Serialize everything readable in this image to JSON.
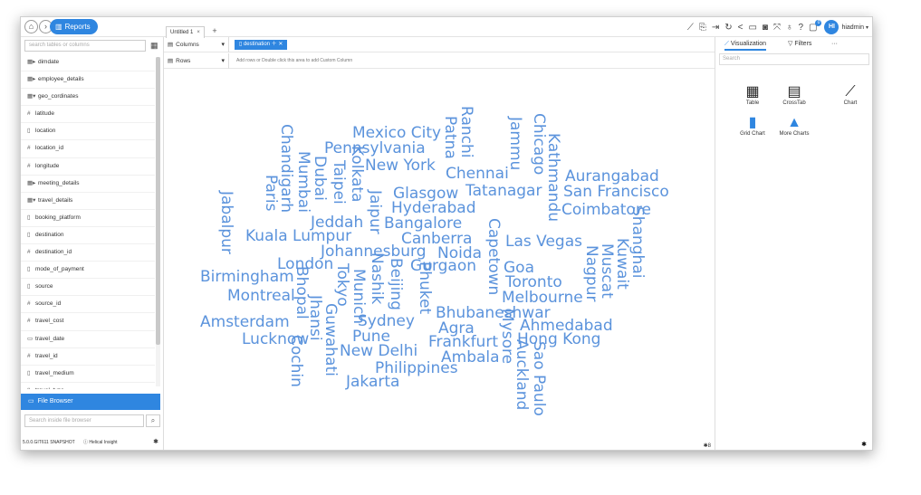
{
  "header": {
    "home_icon": "home-icon",
    "forward_icon": "chevron-right-icon",
    "reports_label": "Reports",
    "tab_label": "Untitled 1",
    "tab_close": "×",
    "tab_add": "+",
    "toolbar_icons": [
      "line-chart-icon",
      "export-icon",
      "exit-icon",
      "refresh-icon",
      "share-icon",
      "layout-icon",
      "camera-icon",
      "fullscreen-icon",
      "bulb-icon",
      "help-icon",
      "notification-icon"
    ],
    "notification_count": "0",
    "avatar_initials": "HI",
    "username": "hiadmin"
  },
  "left_panel": {
    "search_placeholder": "search tables or columns",
    "tree": [
      {
        "label": "dimdate",
        "icon": "table-expand-icon",
        "glyph": "▦▸"
      },
      {
        "label": "employee_details",
        "icon": "table-expand-icon",
        "glyph": "▦▸"
      },
      {
        "label": "geo_cordinates",
        "icon": "table-collapse-icon",
        "glyph": "▦▾"
      },
      {
        "label": "latitude",
        "icon": "numeric-icon",
        "glyph": "#"
      },
      {
        "label": "location",
        "icon": "text-icon",
        "glyph": "▯"
      },
      {
        "label": "location_id",
        "icon": "numeric-icon",
        "glyph": "#"
      },
      {
        "label": "longitude",
        "icon": "numeric-icon",
        "glyph": "#"
      },
      {
        "label": "meeting_details",
        "icon": "table-expand-icon",
        "glyph": "▦▸"
      },
      {
        "label": "travel_details",
        "icon": "table-collapse-icon",
        "glyph": "▦▾"
      },
      {
        "label": "booking_platform",
        "icon": "text-icon",
        "glyph": "▯"
      },
      {
        "label": "destination",
        "icon": "text-icon",
        "glyph": "▯"
      },
      {
        "label": "destination_id",
        "icon": "numeric-icon",
        "glyph": "#"
      },
      {
        "label": "mode_of_payment",
        "icon": "text-icon",
        "glyph": "▯"
      },
      {
        "label": "source",
        "icon": "text-icon",
        "glyph": "▯"
      },
      {
        "label": "source_id",
        "icon": "numeric-icon",
        "glyph": "#"
      },
      {
        "label": "travel_cost",
        "icon": "numeric-icon",
        "glyph": "#"
      },
      {
        "label": "travel_date",
        "icon": "date-icon",
        "glyph": "▭"
      },
      {
        "label": "travel_id",
        "icon": "numeric-icon",
        "glyph": "#"
      },
      {
        "label": "travel_medium",
        "icon": "text-icon",
        "glyph": "▯"
      },
      {
        "label": "travel_type",
        "icon": "text-icon",
        "glyph": "▯"
      }
    ],
    "file_browser_label": "File Browser",
    "file_search_placeholder": "Search inside file browser",
    "version": "5.0.0.GIT611 SNAPSHOT",
    "insight_label": "Helical Insight"
  },
  "center": {
    "columns_label": "Columns",
    "rows_label": "Rows",
    "column_pill": "destination",
    "rows_hint": "Add rows or Double click this area to add Custom Column",
    "footer_text": "8",
    "cloud_color": "#5b93dc",
    "words": [
      {
        "text": "Mexico City",
        "rot": 0
      },
      {
        "text": "Pennsylvania",
        "rot": 0
      },
      {
        "text": "New York",
        "rot": 0
      },
      {
        "text": "Chennai",
        "rot": 0
      },
      {
        "text": "Glasgow",
        "rot": 0
      },
      {
        "text": "Tatanagar",
        "rot": 0
      },
      {
        "text": "Aurangabad",
        "rot": 0
      },
      {
        "text": "San Francisco",
        "rot": 0
      },
      {
        "text": "Hyderabad",
        "rot": 0
      },
      {
        "text": "Coimbatore",
        "rot": 0
      },
      {
        "text": "Jeddah",
        "rot": 0
      },
      {
        "text": "Bangalore",
        "rot": 0
      },
      {
        "text": "Kuala Lumpur",
        "rot": 0
      },
      {
        "text": "Canberra",
        "rot": 0
      },
      {
        "text": "Las Vegas",
        "rot": 0
      },
      {
        "text": "Johannesburg",
        "rot": 0
      },
      {
        "text": "Noida",
        "rot": 0
      },
      {
        "text": "London",
        "rot": 0
      },
      {
        "text": "Gurgaon",
        "rot": 0
      },
      {
        "text": "Goa",
        "rot": 0
      },
      {
        "text": "Birmingham",
        "rot": 0
      },
      {
        "text": "Toronto",
        "rot": 0
      },
      {
        "text": "Montreal",
        "rot": 0
      },
      {
        "text": "Melbourne",
        "rot": 0
      },
      {
        "text": "Bhubaneshwar",
        "rot": 0
      },
      {
        "text": "Amsterdam",
        "rot": 0
      },
      {
        "text": "Sydney",
        "rot": 0
      },
      {
        "text": "Agra",
        "rot": 0
      },
      {
        "text": "Ahmedabad",
        "rot": 0
      },
      {
        "text": "Lucknow",
        "rot": 0
      },
      {
        "text": "Pune",
        "rot": 0
      },
      {
        "text": "Frankfurt",
        "rot": 0
      },
      {
        "text": "Hong Kong",
        "rot": 0
      },
      {
        "text": "New Delhi",
        "rot": 0
      },
      {
        "text": "Ambala",
        "rot": 0
      },
      {
        "text": "Philippines",
        "rot": 0
      },
      {
        "text": "Jakarta",
        "rot": 0
      },
      {
        "text": "Ranchi",
        "rot": 90
      },
      {
        "text": "Patna",
        "rot": 90
      },
      {
        "text": "Jammu",
        "rot": 90
      },
      {
        "text": "Chicago",
        "rot": 90
      },
      {
        "text": "Kathmandu",
        "rot": 90
      },
      {
        "text": "Chandigarh",
        "rot": 90
      },
      {
        "text": "Mumbai",
        "rot": 90
      },
      {
        "text": "Dubai",
        "rot": 90
      },
      {
        "text": "Taipei",
        "rot": 90
      },
      {
        "text": "Kolkata",
        "rot": 90
      },
      {
        "text": "Paris",
        "rot": 90
      },
      {
        "text": "Jaipur",
        "rot": 90
      },
      {
        "text": "Jabalpur",
        "rot": 90
      },
      {
        "text": "Capetown",
        "rot": 90
      },
      {
        "text": "Shanghai",
        "rot": 90
      },
      {
        "text": "Kuwait",
        "rot": 90
      },
      {
        "text": "Muscat",
        "rot": 90
      },
      {
        "text": "Nagpur",
        "rot": 90
      },
      {
        "text": "Nashik",
        "rot": 90
      },
      {
        "text": "Beijing",
        "rot": 90
      },
      {
        "text": "Phuket",
        "rot": 90
      },
      {
        "text": "Bhopal",
        "rot": 90
      },
      {
        "text": "Munich",
        "rot": 90
      },
      {
        "text": "Tokyo",
        "rot": 90
      },
      {
        "text": "Guwahati",
        "rot": 90
      },
      {
        "text": "Jhansi",
        "rot": 90
      },
      {
        "text": "Cochin",
        "rot": 90
      },
      {
        "text": "Mysore",
        "rot": 90
      },
      {
        "text": "Auckland",
        "rot": 90
      },
      {
        "text": "Sao Paulo",
        "rot": 90
      }
    ]
  },
  "right_panel": {
    "tab_visualization": "Visualization",
    "tab_filters": "Filters",
    "tab_more": "···",
    "search_placeholder": "Search",
    "viz_items": [
      {
        "label": "Table",
        "icon": "table-icon",
        "glyph": "▦"
      },
      {
        "label": "CrossTab",
        "icon": "crosstab-icon",
        "glyph": "▤"
      },
      {
        "label": "Chart",
        "icon": "line-chart-icon",
        "glyph": "⟋"
      },
      {
        "label": "Grid Chart",
        "icon": "bar-chart-icon",
        "glyph": "▮"
      },
      {
        "label": "More Charts",
        "icon": "area-chart-icon",
        "glyph": "▲"
      }
    ]
  }
}
